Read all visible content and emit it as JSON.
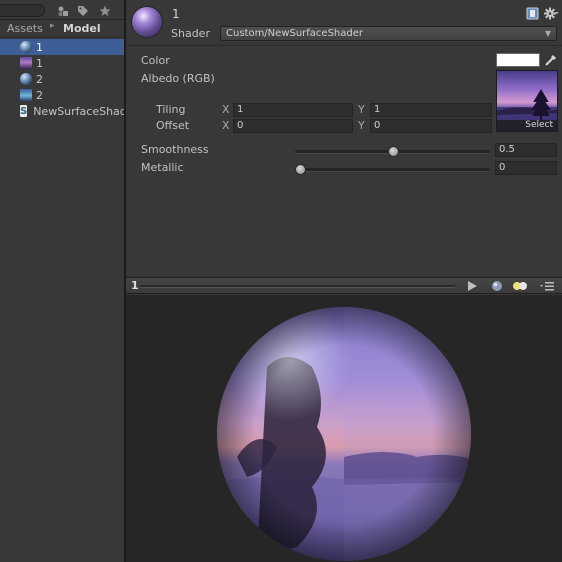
{
  "project": {
    "breadcrumb": {
      "root": "Assets",
      "separator": "▸",
      "current": "Model"
    },
    "assets": [
      {
        "label": "1",
        "type": "material",
        "selected": true
      },
      {
        "label": "1",
        "type": "texture",
        "selected": false
      },
      {
        "label": "2",
        "type": "material",
        "selected": false
      },
      {
        "label": "2",
        "type": "texture",
        "selected": false
      },
      {
        "label": "NewSurfaceShader",
        "type": "shader",
        "selected": false
      }
    ],
    "shader_icon_letter": "S"
  },
  "inspector": {
    "material_name": "1",
    "shader_label": "Shader",
    "shader_value": "Custom/NewSurfaceShader",
    "color_label": "Color",
    "color_value": "#ffffff",
    "albedo_label": "Albedo (RGB)",
    "texture_select_label": "Select",
    "tiling_label": "Tiling",
    "offset_label": "Offset",
    "tiling": {
      "x_label": "X",
      "x": "1",
      "y_label": "Y",
      "y": "1"
    },
    "offset": {
      "x_label": "X",
      "x": "0",
      "y_label": "Y",
      "y": "0"
    },
    "smoothness_label": "Smoothness",
    "smoothness_value": "0.5",
    "smoothness_fraction": 0.5,
    "metallic_label": "Metallic",
    "metallic_value": "0",
    "metallic_fraction": 0.0
  },
  "preview": {
    "label": "1"
  },
  "colors": {
    "selection": "#3e5f96",
    "panel": "#383838",
    "preview_bg": "#262626"
  }
}
